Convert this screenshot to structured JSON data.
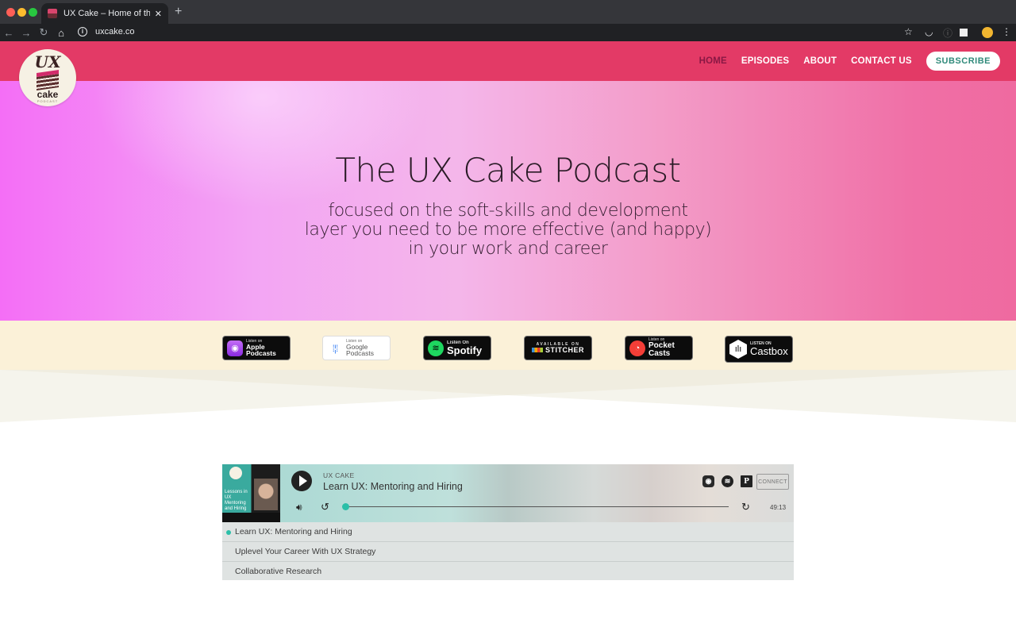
{
  "browser": {
    "tab_title": "UX Cake – Home of the UX Cake Podcast",
    "url": "uxcake.co",
    "new_tab_label": "+",
    "close_tab_label": "✕"
  },
  "site": {
    "logo": {
      "top": "UX",
      "bottom": "cake",
      "sub": "PODCAST"
    },
    "nav": [
      {
        "label": "HOME",
        "active": true
      },
      {
        "label": "EPISODES"
      },
      {
        "label": "ABOUT"
      },
      {
        "label": "CONTACT US"
      }
    ],
    "subscribe_label": "SUBSCRIBE",
    "colors": {
      "header": "#e33a66",
      "accent": "#2bbfa8",
      "active_nav": "#8a1844"
    }
  },
  "hero": {
    "title": "The UX Cake Podcast",
    "subtitle_lines": [
      "focused on the soft-skills and development",
      "layer you need to be more effective (and happy)",
      "in your work and career"
    ]
  },
  "badges": [
    {
      "small": "Listen on",
      "big": "Apple Podcasts",
      "icon": "apple-podcasts-icon"
    },
    {
      "small": "Listen on",
      "big": "Google Podcasts",
      "icon": "google-podcasts-icon"
    },
    {
      "small": "Listen On",
      "big": "Spotify",
      "icon": "spotify-icon"
    },
    {
      "small": "AVAILABLE ON",
      "big": "STITCHER",
      "icon": "stitcher-icon"
    },
    {
      "small": "Listen on",
      "big": "Pocket Casts",
      "icon": "pocket-casts-icon"
    },
    {
      "small": "LISTEN ON",
      "big": "Castbox",
      "icon": "castbox-icon"
    }
  ],
  "player": {
    "show": "UX CAKE",
    "episode_title": "Learn UX: Mentoring and Hiring",
    "cover_text": "Lessons in UX Mentoring and Hiring",
    "duration": "49:13",
    "progress": 0,
    "connect_label": "CONNECT",
    "playlist": [
      {
        "title": "Learn UX: Mentoring and Hiring",
        "current": true
      },
      {
        "title": "Uplevel Your Career With UX Strategy"
      },
      {
        "title": "Collaborative Research"
      }
    ]
  }
}
